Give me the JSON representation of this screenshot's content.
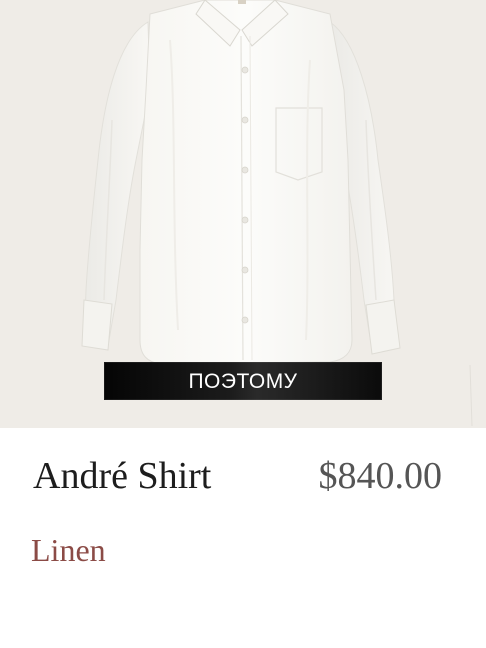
{
  "product": {
    "badge": "ПОЭТОМУ",
    "name": "André Shirt",
    "price": "$840.00",
    "material": "Linen"
  },
  "colors": {
    "image_background": "#efece7",
    "name": "#1d1d1d",
    "price": "#555555",
    "material": "#8b4b46",
    "badge_background": "#0b0b0b"
  },
  "icons": {
    "product_image": "white-shirt-photo"
  }
}
